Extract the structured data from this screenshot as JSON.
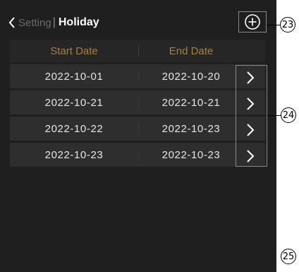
{
  "header": {
    "back_label": "Setting",
    "separator": "|",
    "title": "Holiday"
  },
  "table": {
    "columns": [
      "Start Date",
      "End Date"
    ],
    "rows": [
      {
        "start": "2022-10-01",
        "end": "2022-10-20"
      },
      {
        "start": "2022-10-21",
        "end": "2022-10-21"
      },
      {
        "start": "2022-10-22",
        "end": "2022-10-23"
      },
      {
        "start": "2022-10-23",
        "end": "2022-10-23"
      }
    ]
  },
  "callouts": {
    "add": "23",
    "rows": "24",
    "bottom": "25"
  },
  "colors": {
    "header_text": "#a8803e",
    "background": "#1f1f1f",
    "row": "#2e2e2e"
  }
}
